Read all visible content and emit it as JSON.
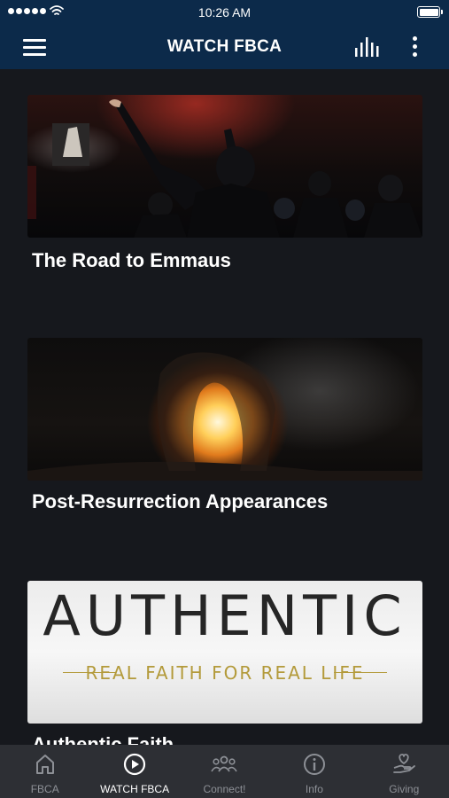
{
  "status_bar": {
    "time": "10:26 AM",
    "signal_icon": "signal-dots-icon",
    "wifi_icon": "wifi-icon",
    "battery_icon": "battery-icon"
  },
  "app_bar": {
    "title": "WATCH FBCA",
    "menu_icon": "hamburger-menu-icon",
    "audio_icon": "audio-bars-icon",
    "more_icon": "more-vertical-icon",
    "background_color": "#0c2a4a"
  },
  "feed": {
    "items": [
      {
        "title": "The Road to Emmaus",
        "thumbnail": "worship-concert-photo"
      },
      {
        "title": "Post-Resurrection Appearances",
        "thumbnail": "empty-tomb-photo"
      },
      {
        "title": "Authentic Faith",
        "thumbnail": "authentic-series-artwork",
        "artwork_text": {
          "headline": "AUTHENTIC",
          "tagline": "REAL FAITH FOR REAL LIFE"
        }
      }
    ]
  },
  "tab_bar": {
    "active_tab": "WATCH FBCA",
    "tabs": [
      {
        "label": "FBCA",
        "icon": "home-icon"
      },
      {
        "label": "WATCH FBCA",
        "icon": "play-circle-icon"
      },
      {
        "label": "Connect!",
        "icon": "group-people-icon"
      },
      {
        "label": "Info",
        "icon": "info-circle-icon"
      },
      {
        "label": "Giving",
        "icon": "heart-hand-icon"
      }
    ],
    "active_color": "#ffffff",
    "inactive_color": "#8d9096"
  }
}
